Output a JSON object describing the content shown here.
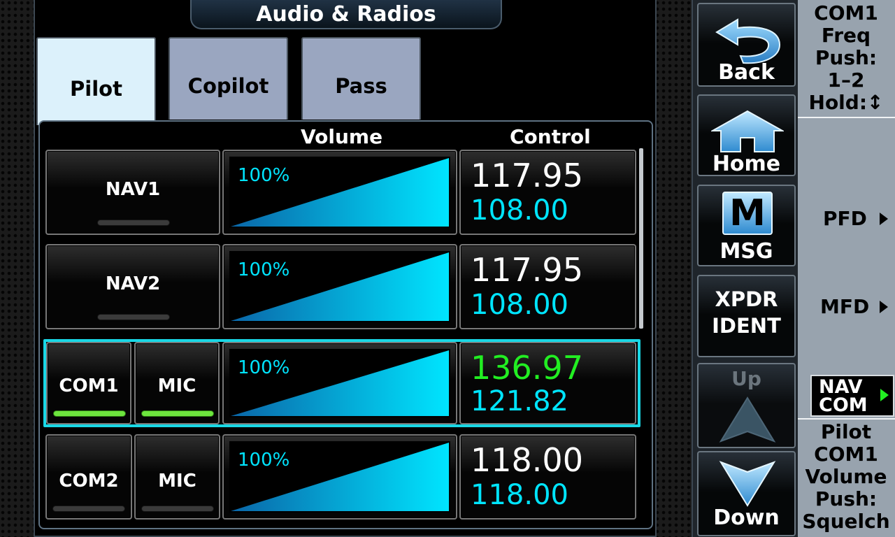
{
  "window": {
    "title": "Audio & Radios"
  },
  "tabs": [
    {
      "label": "Pilot",
      "active": true
    },
    {
      "label": "Copilot",
      "active": false
    },
    {
      "label": "Pass",
      "active": false
    }
  ],
  "columns": {
    "volume": "Volume",
    "control": "Control"
  },
  "rows": [
    {
      "radio": "NAV1",
      "mic": null,
      "radio_active": false,
      "mic_active": false,
      "volume": 1.0,
      "volume_text": "100%",
      "active_freq": "117.95",
      "standby_freq": "108.00",
      "selected": false
    },
    {
      "radio": "NAV2",
      "mic": null,
      "radio_active": false,
      "mic_active": false,
      "volume": 1.0,
      "volume_text": "100%",
      "active_freq": "117.95",
      "standby_freq": "108.00",
      "selected": false
    },
    {
      "radio": "COM1",
      "mic": "MIC",
      "radio_active": true,
      "mic_active": true,
      "volume": 1.0,
      "volume_text": "100%",
      "active_freq": "136.97",
      "standby_freq": "121.82",
      "selected": true
    },
    {
      "radio": "COM2",
      "mic": "MIC",
      "radio_active": false,
      "mic_active": false,
      "volume": 1.0,
      "volume_text": "100%",
      "active_freq": "118.00",
      "standby_freq": "118.00",
      "selected": false
    }
  ],
  "side_buttons": {
    "back": "Back",
    "home": "Home",
    "msg": "MSG",
    "msg_glyph": "M",
    "xpdr_line1": "XPDR",
    "xpdr_line2": "IDENT",
    "up": "Up",
    "down": "Down"
  },
  "softkeys": {
    "top": [
      "COM1",
      "Freq",
      "Push:",
      "1–2",
      "Hold:↕"
    ],
    "pfd": "PFD",
    "mfd": "MFD",
    "navcom_line1": "NAV",
    "navcom_line2": "COM",
    "bottom": [
      "Pilot",
      "COM1",
      "Volume",
      "Push:",
      "Squelch"
    ]
  },
  "colors": {
    "active_freq_selected": "#22ee22",
    "standby_freq": "#00e5ff",
    "volume_fill": "#00e5ff",
    "indicator_on": "#6ee63e",
    "selection_frame": "#19d8e6"
  },
  "icons": {
    "back": "back-arrow-icon",
    "home": "home-icon",
    "msg": "message-icon",
    "up": "up-arrow-icon",
    "down": "down-arrow-icon",
    "softkey": "right-triangle-icon"
  }
}
